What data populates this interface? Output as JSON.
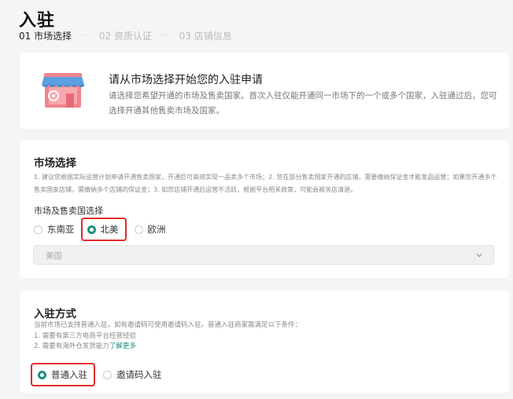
{
  "header": {
    "title": "入驻",
    "steps": [
      {
        "label": "01 市场选择",
        "active": true
      },
      {
        "label": "02 资质认证",
        "active": false
      },
      {
        "label": "03 店铺信息",
        "active": false
      }
    ],
    "dots": "····"
  },
  "intro": {
    "icon": "shop-icon",
    "title": "请从市场选择开始您的入驻申请",
    "desc": "请选择您希望开通的市场及售卖国家。首次入驻仅能开通同一市场下的一个或多个国家，入驻通过后，您可选择开通其他售卖市场及国家。"
  },
  "market": {
    "title": "市场选择",
    "notes": "1. 建议您根据实际运营计划申请开通售卖国家，开通后可高效实现一品卖多个市场；2. 您在部分售卖国家开通的店铺，需要缴纳保证金才能发品运营；如果您开通多个售卖国家店铺，需缴纳多个店铺的保证金；3. 如您店铺开通后运营不活跃，根据平台相关政策，可能会被关店清退。",
    "sublabel": "市场及售卖国选择",
    "options": [
      "东南亚",
      "北美",
      "欧洲"
    ],
    "selected": "北美",
    "country": {
      "value": "美国",
      "icon": "chevron-down-icon"
    }
  },
  "mode": {
    "title": "入驻方式",
    "line1": "当前市场已支持普通入驻，如有邀请码可使用邀请码入驻。普通入驻商家需满足以下条件：",
    "line2": "1. 需要有第三方电商平台经营经验",
    "line3": "2. 需要有海外仓发货能力",
    "link": "了解更多",
    "options": [
      "普通入驻",
      "邀请码入驻"
    ],
    "selected": "普通入驻"
  },
  "colors": {
    "accent": "#1a8f7f",
    "highlight": "#e22a2a",
    "shop_awning": "#5a9fe0",
    "shop_body": "#f0848d"
  }
}
